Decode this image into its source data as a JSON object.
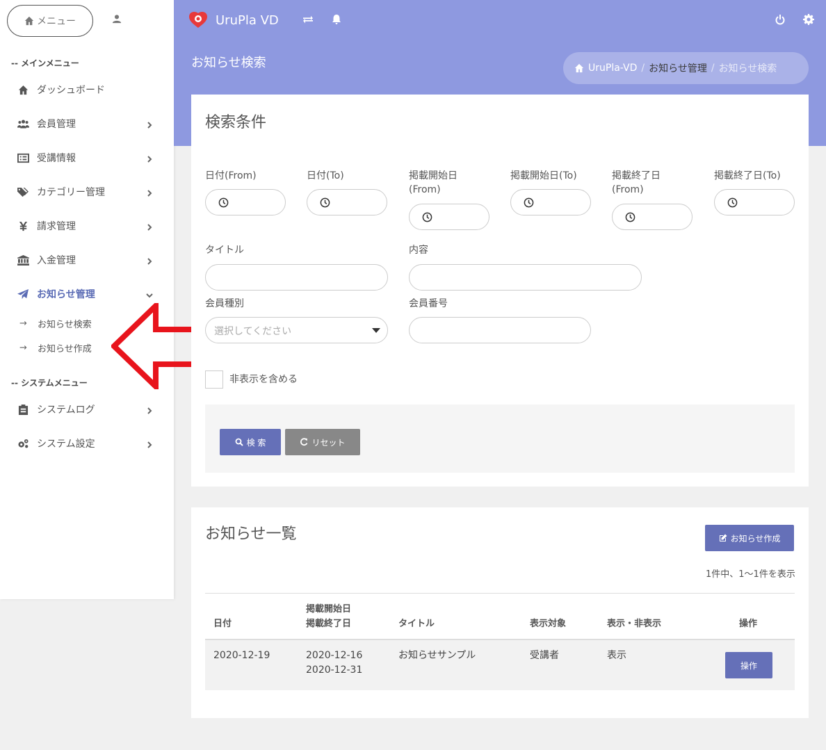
{
  "sidebar": {
    "menu_label": "メニュー",
    "main_section": "-- メインメニュー",
    "system_section": "-- システムメニュー",
    "items": [
      {
        "label": "ダッシュボード"
      },
      {
        "label": "会員管理"
      },
      {
        "label": "受講情報"
      },
      {
        "label": "カテゴリー管理"
      },
      {
        "label": "請求管理"
      },
      {
        "label": "入金管理"
      },
      {
        "label": "お知らせ管理"
      }
    ],
    "sub_items": [
      {
        "label": "お知らせ検索"
      },
      {
        "label": "お知らせ作成"
      }
    ],
    "system_items": [
      {
        "label": "システムログ"
      },
      {
        "label": "システム設定"
      }
    ]
  },
  "header": {
    "app_name": "UruPla VD",
    "page_title": "お知らせ検索",
    "breadcrumb": {
      "home": "UruPla-VD",
      "parent": "お知らせ管理",
      "current": "お知らせ検索",
      "sep": "/"
    }
  },
  "search": {
    "title": "検索条件",
    "date_from": "日付(From)",
    "date_to": "日付(To)",
    "pub_start_from_1": "掲載開始日",
    "pub_start_from_2": "(From)",
    "pub_start_to": "掲載開始日(To)",
    "pub_end_from_1": "掲載終了日",
    "pub_end_from_2": "(From)",
    "pub_end_to": "掲載終了日(To)",
    "title_label": "タイトル",
    "content_label": "内容",
    "member_type_label": "会員種別",
    "member_type_placeholder": "選択してください",
    "member_no_label": "会員番号",
    "include_hidden": "非表示を含める",
    "search_button": "検 索",
    "reset_button": "リセット"
  },
  "list": {
    "title": "お知らせ一覧",
    "create_button": "お知らせ作成",
    "count_text": "1件中、1〜1件を表示",
    "headers": {
      "date": "日付",
      "pub_start": "掲載開始日",
      "pub_end": "掲載終了日",
      "title": "タイトル",
      "target": "表示対象",
      "visibility": "表示・非表示",
      "action": "操作"
    },
    "rows": [
      {
        "date": "2020-12-19",
        "pub_start": "2020-12-16",
        "pub_end": "2020-12-31",
        "title": "お知らせサンプル",
        "target": "受講者",
        "visibility": "表示",
        "action": "操作"
      }
    ]
  },
  "colors": {
    "accent": "#8e99e0",
    "primary_button": "#6570b8",
    "arrow": "#e8141c"
  }
}
